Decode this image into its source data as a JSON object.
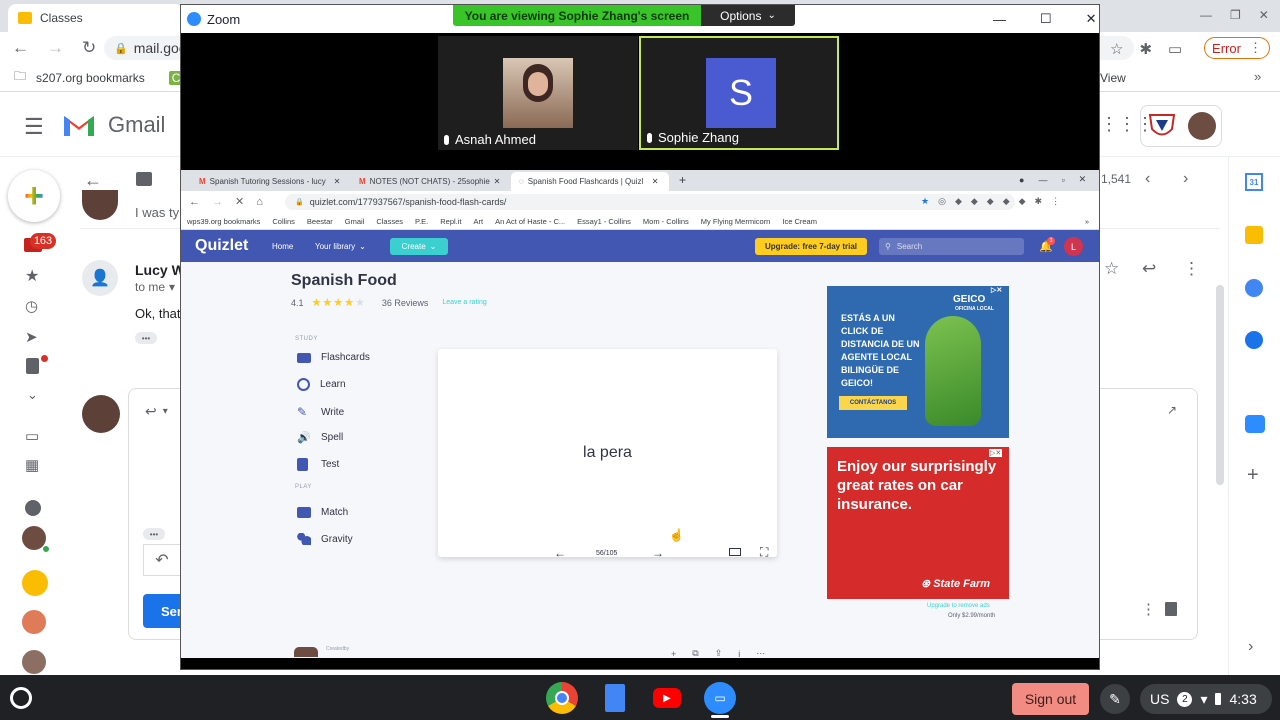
{
  "chrome": {
    "tab_title": "Classes",
    "url": "mail.goo",
    "bookmarks": [
      "s207.org bookmarks",
      "C",
      "View"
    ],
    "error_label": "Error"
  },
  "gmail": {
    "logo_text": "Gmail",
    "badge_count": "163",
    "msg_count": "1,541",
    "email1_snippet": "I was ty",
    "sender": "Lucy Wa",
    "to_me": "to me",
    "body_snippet": "Ok, that'",
    "send_label": "Sen",
    "dots": "•••"
  },
  "zoom": {
    "title": "Zoom",
    "banner": "You are viewing Sophie Zhang's screen",
    "options": "Options",
    "participants": [
      {
        "name": "Asnah Ahmed"
      },
      {
        "name": "Sophie Zhang",
        "initial": "S"
      }
    ]
  },
  "shared": {
    "tabs": [
      "Spanish Tutoring Sessions - lucy",
      "NOTES (NOT CHATS) - 25sophie",
      "Spanish Food Flashcards | Quizl"
    ],
    "url": "quizlet.com/177937567/spanish-food-flash-cards/",
    "bookmarks": [
      "wps39.org bookmarks",
      "Collins",
      "Beestar",
      "Gmail",
      "Classes",
      "P.E.",
      "Repl.it",
      "Art",
      "An Act of Haste - C...",
      "Essay1 - Collins",
      "Mom - Collins",
      "My Flying Mermicorn",
      "Ice Cream"
    ],
    "quizlet": {
      "logo": "Quizlet",
      "nav": [
        "Home",
        "Your library"
      ],
      "create": "Create",
      "upgrade": "Upgrade: free 7-day trial",
      "search_placeholder": "Search",
      "notif_count": "1",
      "avatar": "L",
      "set_title": "Spanish Food",
      "rating_value": "4.1",
      "rating_fraction": 0.82,
      "reviews": "36 Reviews",
      "leave_rating": "Leave a rating",
      "study_head": "STUDY",
      "study_items": [
        "Flashcards",
        "Learn",
        "Write",
        "Spell",
        "Test"
      ],
      "play_head": "PLAY",
      "play_items": [
        "Match",
        "Gravity"
      ],
      "card_text": "la pera",
      "progress": "56/105",
      "ad1_text": "ESTÁS A UN CLICK DE DISTANCIA DE UN AGENTE LOCAL BILINGÜE DE GEICO!",
      "ad1_brand": "GEICO",
      "ad1_sub": "OFICINA LOCAL",
      "ad1_cta": "CONTÁCTANOS",
      "ad2_text": "Enjoy our surprisingly great rates on car insurance.",
      "ad2_brand": "State Farm",
      "upgrade_ads": "Upgrade to remove ads",
      "price": "Only $2.99/month",
      "creator": "Createdby"
    }
  },
  "taskbar": {
    "signout": "Sign out",
    "locale": "US",
    "notif": "2",
    "time": "4:33"
  },
  "colors": {
    "quizlet_nav": "#4257b2",
    "zoom_banner": "#39c42a",
    "signout": "#f28b82",
    "gmail_red": "#ea4335"
  }
}
